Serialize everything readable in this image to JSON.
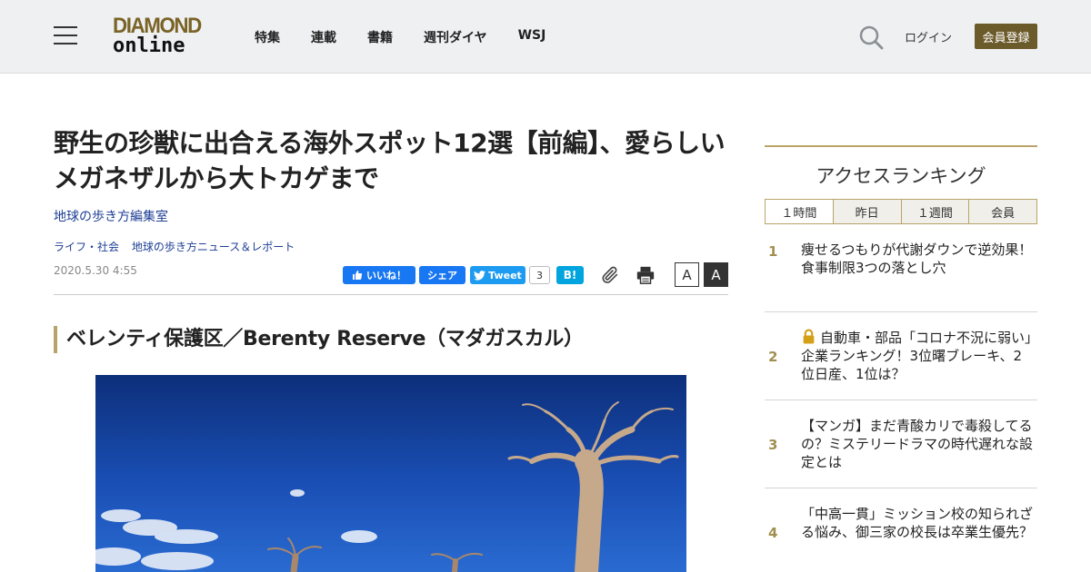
{
  "header": {
    "logo_line1": "DIAMOND",
    "logo_line2": "online",
    "nav": [
      "特集",
      "連載",
      "書籍",
      "週刊ダイヤ",
      "WSJ"
    ],
    "login_label": "ログイン",
    "register_label": "会員登録"
  },
  "article": {
    "title": "野生の珍獣に出合える海外スポット12選【前編】、愛らしいメガネザルから大トカゲまで",
    "author": "地球の歩き方編集室",
    "categories": [
      "ライフ・社会",
      "地球の歩き方ニュース＆レポート"
    ],
    "date": "2020.5.30 4:55",
    "share": {
      "like_label": "いいね！",
      "share_label": "シェア",
      "tweet_label": "Tweet",
      "tweet_count": "3",
      "hatena_label": "B!",
      "font_small_label": "A",
      "font_large_label": "A"
    },
    "section_heading": "ベレンティ保護区／Berenty Reserve（マダガスカル）"
  },
  "ranking": {
    "title": "アクセスランキング",
    "tabs": [
      "１時間",
      "昨日",
      "１週間",
      "会員"
    ],
    "items": [
      {
        "rank": "1",
        "title": "痩せるつもりが代謝ダウンで逆効果！食事制限3つの落とし穴"
      },
      {
        "rank": "2",
        "title": "自動車・部品「コロナ不況に弱い」企業ランキング！3位曙ブレーキ、2位日産、1位は？"
      },
      {
        "rank": "3",
        "title": "【マンガ】まだ青酸カリで毒殺してるの？ミステリードラマの時代遅れな設定とは"
      },
      {
        "rank": "4",
        "title": "「中高一貫」ミッション校の知られざる悩み、御三家の校長は卒業生優先？"
      }
    ]
  },
  "colors": {
    "brand_gold": "#b8a46a",
    "register_bg": "#6b5a2a",
    "link_blue": "#1d3e95",
    "facebook": "#1877f2",
    "twitter": "#1d9bf0",
    "hatena": "#00a4de"
  },
  "icons": [
    "menu-icon",
    "search-icon",
    "facebook-like-icon",
    "twitter-bird-icon",
    "clip-icon",
    "print-icon",
    "lock-icon"
  ]
}
